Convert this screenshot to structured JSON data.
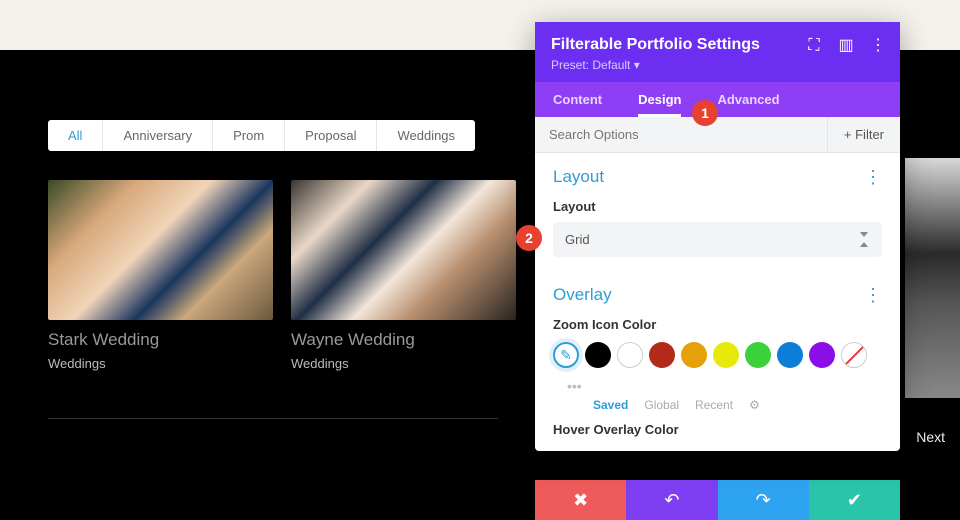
{
  "filters": {
    "all": "All",
    "anniversary": "Anniversary",
    "prom": "Prom",
    "proposal": "Proposal",
    "weddings": "Weddings"
  },
  "cards": [
    {
      "title": "Stark Wedding",
      "category": "Weddings"
    },
    {
      "title": "Wayne Wedding",
      "category": "Weddings"
    }
  ],
  "nav": {
    "next": "Next"
  },
  "panel": {
    "title": "Filterable Portfolio Settings",
    "preset": "Preset: Default",
    "tabs": {
      "content": "Content",
      "design": "Design",
      "advanced": "Advanced"
    },
    "search_placeholder": "Search Options",
    "filter_button": "Filter",
    "layout": {
      "section": "Layout",
      "field": "Layout",
      "value": "Grid"
    },
    "overlay": {
      "section": "Overlay",
      "zoom_label": "Zoom Icon Color",
      "hover_label": "Hover Overlay Color",
      "sublinks": {
        "saved": "Saved",
        "global": "Global",
        "recent": "Recent"
      }
    },
    "swatches": {
      "black": "#000000",
      "white": "#ffffff",
      "red": "#b22a1a",
      "orange": "#e6a008",
      "yellow": "#e8e80b",
      "green": "#3bd13b",
      "blue": "#0c7ed9",
      "purple": "#8a0ee6"
    }
  },
  "callouts": {
    "one": "1",
    "two": "2"
  }
}
